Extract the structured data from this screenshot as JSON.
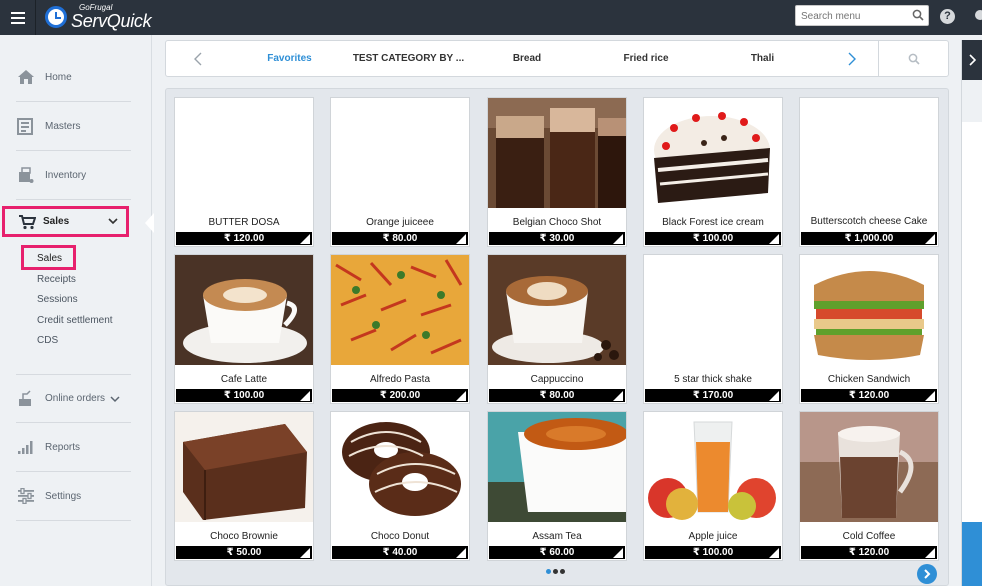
{
  "app": {
    "brand_small": "GoFrugal",
    "brand_name": "ServQuick"
  },
  "topbar": {
    "search_placeholder": "Search menu",
    "help_label": "?"
  },
  "sidebar": {
    "items": [
      {
        "label": "Home",
        "icon": "home-icon"
      },
      {
        "label": "Masters",
        "icon": "masters-icon"
      },
      {
        "label": "Inventory",
        "icon": "inventory-icon"
      },
      {
        "label": "Sales",
        "icon": "cart-icon"
      },
      {
        "label": "Online orders",
        "icon": "online-orders-icon"
      },
      {
        "label": "Reports",
        "icon": "reports-icon"
      },
      {
        "label": "Settings",
        "icon": "settings-icon"
      }
    ],
    "sales_submenu": [
      "Sales",
      "Receipts",
      "Sessions",
      "Credit settlement",
      "CDS"
    ]
  },
  "categories": {
    "tabs": [
      "Favorites",
      "TEST CATEGORY BY ...",
      "Bread",
      "Fried rice",
      "Thali"
    ],
    "active": "Favorites"
  },
  "products": [
    {
      "name": "BUTTER DOSA",
      "price": "₹ 120.00",
      "image": "blank"
    },
    {
      "name": "Orange juiceee",
      "price": "₹ 80.00",
      "image": "blank"
    },
    {
      "name": "Belgian Choco Shot",
      "price": "₹ 30.00",
      "image": "choco-shot"
    },
    {
      "name": "Black Forest ice cream",
      "price": "₹ 100.00",
      "image": "black-forest"
    },
    {
      "name": "Butterscotch cheese Cake",
      "price": "₹ 1,000.00",
      "image": "blank"
    },
    {
      "name": "Cafe Latte",
      "price": "₹ 100.00",
      "image": "latte"
    },
    {
      "name": "Alfredo Pasta",
      "price": "₹ 200.00",
      "image": "pasta"
    },
    {
      "name": "Cappuccino",
      "price": "₹ 80.00",
      "image": "cappuccino"
    },
    {
      "name": "5 star thick shake",
      "price": "₹ 170.00",
      "image": "blank"
    },
    {
      "name": "Chicken Sandwich",
      "price": "₹ 120.00",
      "image": "sandwich"
    },
    {
      "name": "Choco Brownie",
      "price": "₹ 50.00",
      "image": "brownie"
    },
    {
      "name": "Choco Donut",
      "price": "₹ 40.00",
      "image": "donut"
    },
    {
      "name": "Assam Tea",
      "price": "₹ 60.00",
      "image": "tea"
    },
    {
      "name": "Apple juice",
      "price": "₹ 100.00",
      "image": "apple-juice"
    },
    {
      "name": "Cold Coffee",
      "price": "₹ 120.00",
      "image": "cold-coffee"
    }
  ],
  "pager": {
    "pages": 3,
    "current": 1
  },
  "colors": {
    "accent": "#2f8fd6",
    "highlight": "#e7216d",
    "topbar": "#2b333d"
  }
}
